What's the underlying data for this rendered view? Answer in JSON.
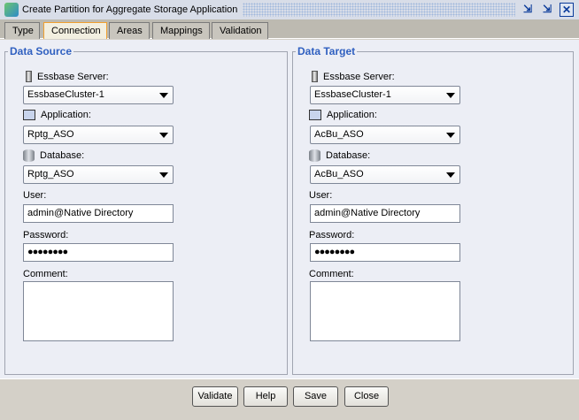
{
  "window": {
    "title": "Create Partition for Aggregate Storage Application",
    "buttons": [
      "restore",
      "minimize",
      "close"
    ]
  },
  "tabs": [
    {
      "label": "Type"
    },
    {
      "label": "Connection",
      "active": true
    },
    {
      "label": "Areas"
    },
    {
      "label": "Mappings"
    },
    {
      "label": "Validation"
    }
  ],
  "source": {
    "legend": "Data Source",
    "server_label": "Essbase Server:",
    "server": "EssbaseCluster-1",
    "app_label": "Application:",
    "app": "Rptg_ASO",
    "db_label": "Database:",
    "db": "Rptg_ASO",
    "user_label": "User:",
    "user": "admin@Native Directory",
    "password_label": "Password:",
    "password": "●●●●●●●●",
    "comment_label": "Comment:",
    "comment": ""
  },
  "target": {
    "legend": "Data Target",
    "server_label": "Essbase Server:",
    "server": "EssbaseCluster-1",
    "app_label": "Application:",
    "app": "AcBu_ASO",
    "db_label": "Database:",
    "db": "AcBu_ASO",
    "user_label": "User:",
    "user": "admin@Native Directory",
    "password_label": "Password:",
    "password": "●●●●●●●●",
    "comment_label": "Comment:",
    "comment": ""
  },
  "footer": {
    "validate": "Validate",
    "help": "Help",
    "save": "Save",
    "close": "Close"
  }
}
